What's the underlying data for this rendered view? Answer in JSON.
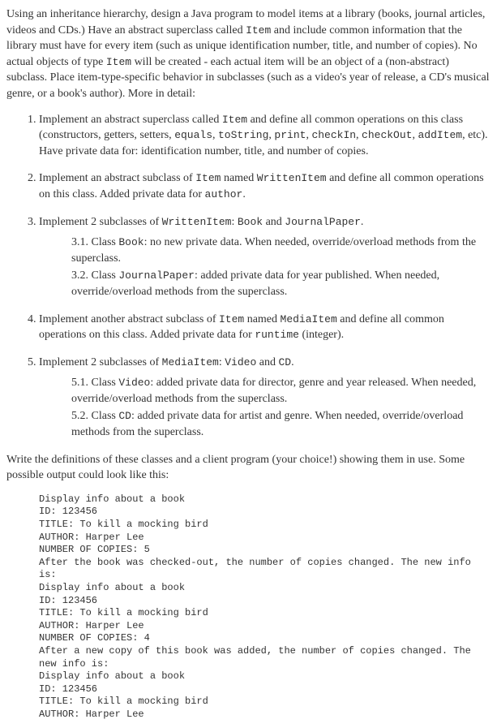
{
  "intro": {
    "p1a": "Using an inheritance hierarchy, design a Java program to model items at a library (books, journal articles, videos and CDs.) Have an abstract superclass called ",
    "code1": "Item",
    "p1b": " and include common information that the library must have for every item (such as unique identification number, title, and number of copies). No actual objects of type ",
    "code2": "Item",
    "p1c": " will be created - each actual item will be an object of a (non-abstract) subclass. Place item-type-specific behavior in subclasses (such as a video's year of release, a CD's musical genre, or a book's author). More in detail:"
  },
  "list": {
    "i1a": "Implement an abstract superclass called ",
    "i1code1": "Item",
    "i1b": " and define all common operations on this class (constructors, getters, setters, ",
    "i1code2": "equals",
    "i1sep1": ", ",
    "i1code3": "toString",
    "i1sep2": ", ",
    "i1code4": "print",
    "i1sep3": ", ",
    "i1code5": "checkIn",
    "i1sep4": ", ",
    "i1code6": "checkOut",
    "i1sep5": ", ",
    "i1code7": "addItem",
    "i1c": ", etc). Have private data for: identification number, title, and number of copies.",
    "i2a": "Implement an abstract subclass of ",
    "i2code1": "Item",
    "i2b": " named ",
    "i2code2": "WrittenItem",
    "i2c": " and define all common operations on this class. Added private data for ",
    "i2code3": "author",
    "i2d": ".",
    "i3a": "Implement 2 subclasses of ",
    "i3code1": "WrittenItem",
    "i3b": ": ",
    "i3code2": "Book",
    "i3c": " and ",
    "i3code3": "JournalPaper",
    "i3d": ".",
    "i31a": "3.1. Class ",
    "i31code": "Book",
    "i31b": ": no new private data. When needed, override/overload methods from the superclass.",
    "i32a": "3.2. Class ",
    "i32code": "JournalPaper",
    "i32b": ": added private data for year published. When needed, override/overload methods from the superclass.",
    "i4a": "Implement another abstract subclass of ",
    "i4code1": "Item",
    "i4b": " named ",
    "i4code2": "MediaItem",
    "i4c": " and define all common operations on this class. Added private data for ",
    "i4code3": "runtime",
    "i4d": " (integer).",
    "i5a": "Implement 2 subclasses of ",
    "i5code1": "MediaItem",
    "i5b": ": ",
    "i5code2": "Video",
    "i5c": " and ",
    "i5code3": "CD",
    "i5d": ".",
    "i51a": "5.1. Class ",
    "i51code": "Video",
    "i51b": ": added private data for director, genre and year released. When needed, override/overload methods from the superclass.",
    "i52a": "5.2. Class ",
    "i52code": "CD",
    "i52b": ": added private data for artist and genre. When needed, override/overload methods from the superclass."
  },
  "closing": "Write the definitions of these classes and a client program (your choice!) showing them in use. Some possible output could look like this:",
  "output": "Display info about a book\nID: 123456\nTITLE: To kill a mocking bird\nAUTHOR: Harper Lee\nNUMBER OF COPIES: 5\nAfter the book was checked-out, the number of copies changed. The new info is:\nDisplay info about a book\nID: 123456\nTITLE: To kill a mocking bird\nAUTHOR: Harper Lee\nNUMBER OF COPIES: 4\nAfter a new copy of this book was added, the number of copies changed. The new info is:\nDisplay info about a book\nID: 123456\nTITLE: To kill a mocking bird\nAUTHOR: Harper Lee"
}
